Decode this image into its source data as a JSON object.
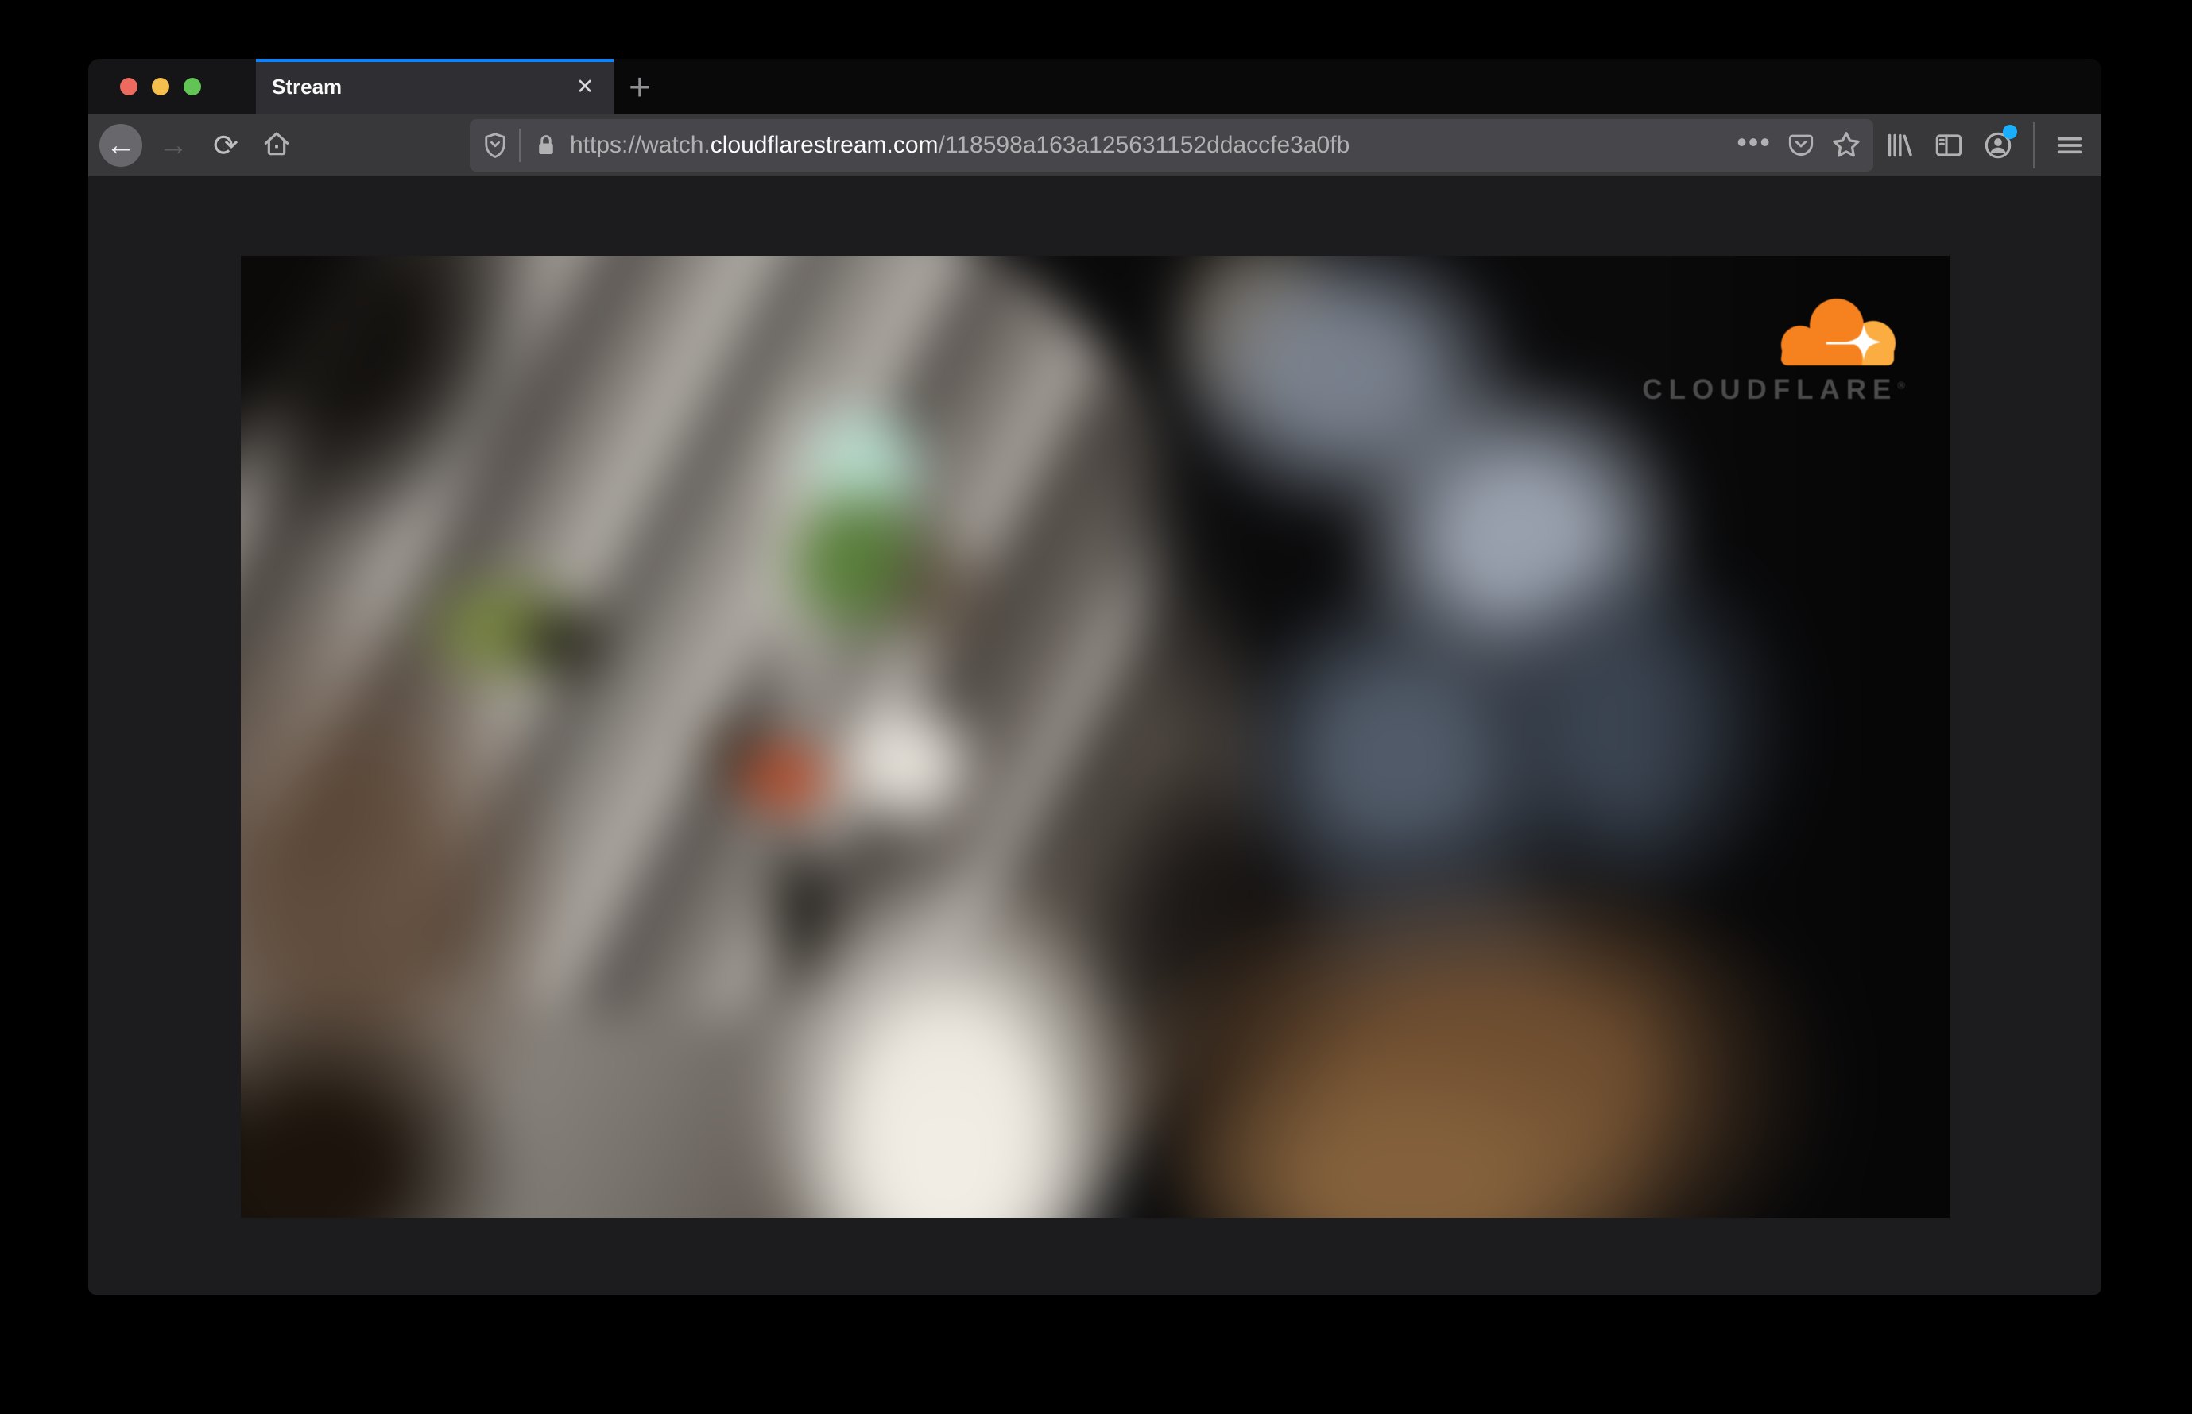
{
  "tab_bar": {
    "tab_title": "Stream",
    "close_glyph": "✕",
    "new_tab_glyph": "+"
  },
  "toolbar": {
    "back_glyph": "←",
    "forward_glyph": "→",
    "reload_glyph": "⟳",
    "page_actions_glyph": "•••",
    "url": {
      "prefix": "https://watch.",
      "domain": "cloudflarestream.com",
      "path": "/118598a163a125631152ddaccfe3a0fb"
    }
  },
  "video": {
    "watermark_text": "CLOUDFLARE",
    "watermark_mark": "®"
  },
  "colors": {
    "accent_blue": "#0a84ff",
    "traffic_red": "#ed6a5e",
    "traffic_yellow": "#f5bf4f",
    "traffic_green": "#61c454",
    "cloudflare_orange": "#f6821f",
    "cloudflare_orange_light": "#fbad41",
    "toolbar_bg": "#38383b",
    "urlbar_bg": "#47474b",
    "tab_bg": "#2f2f33",
    "content_bg": "#1c1c1e",
    "icon_gray": "#b1b1b3",
    "url_bright": "#fbfbfe"
  }
}
